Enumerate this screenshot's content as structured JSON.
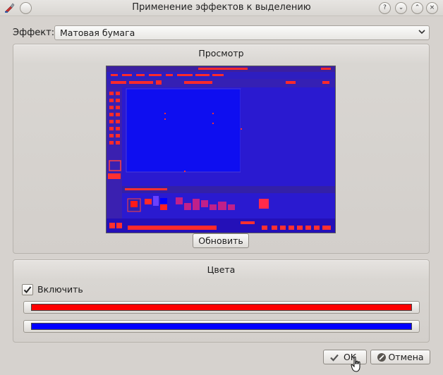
{
  "window": {
    "title": "Применение эффектов к выделению",
    "help_glyph": "?",
    "shade_glyph": "⌄",
    "maximize_glyph": "⌃",
    "close_glyph": "×"
  },
  "effect": {
    "label": "Эффект:",
    "selected": "Матовая бумага"
  },
  "preview": {
    "title": "Просмотр",
    "refresh_label": "Обновить"
  },
  "colors": {
    "title": "Цвета",
    "enable_label": "Включить",
    "enabled": true,
    "color1": "#ff0000",
    "color2": "#0000ff"
  },
  "buttons": {
    "ok_label": "OK",
    "cancel_label": "Отмена"
  },
  "icons": {
    "app": "paintbrush-icon",
    "ok": "checkmark-icon",
    "cancel": "cancel-icon",
    "combo_arrow": "chevron-down-icon"
  }
}
